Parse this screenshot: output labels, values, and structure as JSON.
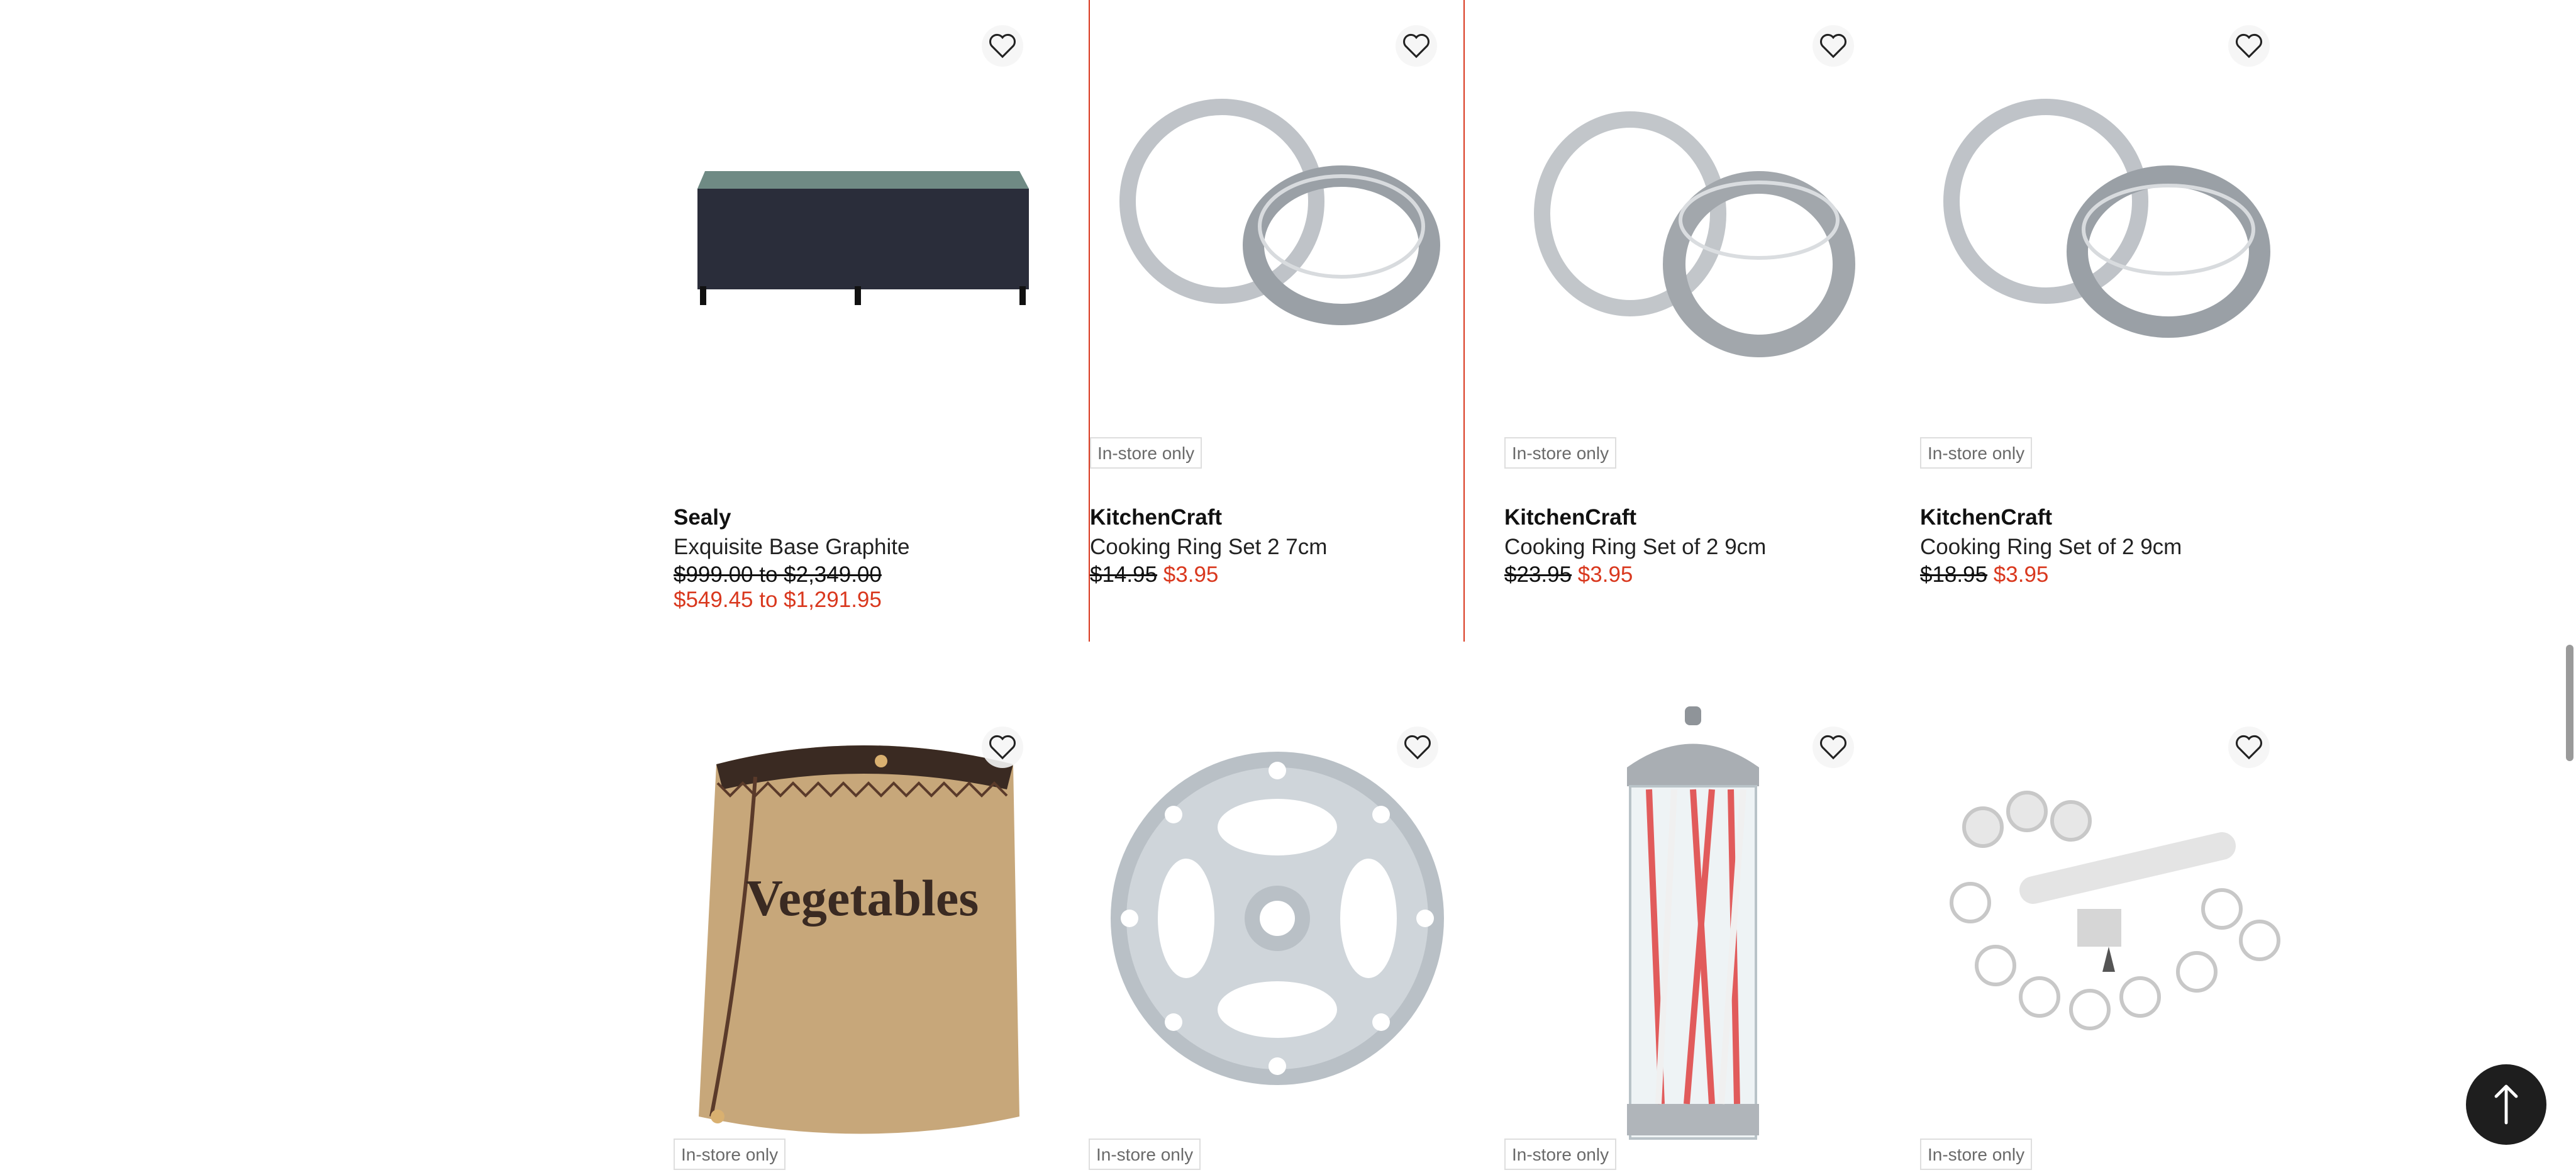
{
  "products_row1": [
    {
      "brand": "Sealy",
      "name": "Exquisite Base Graphite",
      "was": "$999.00 to $2,349.00",
      "now": "$549.45 to $1,291.95",
      "badge": ""
    },
    {
      "brand": "KitchenCraft",
      "name": "Cooking Ring Set 2 7cm",
      "was": "$14.95",
      "now": "$3.95",
      "badge": "In-store only"
    },
    {
      "brand": "KitchenCraft",
      "name": "Cooking Ring Set of 2 9cm",
      "was": "$23.95",
      "now": "$3.95",
      "badge": "In-store only"
    },
    {
      "brand": "KitchenCraft",
      "name": "Cooking Ring Set of 2 9cm",
      "was": "$18.95",
      "now": "$3.95",
      "badge": "In-store only"
    }
  ],
  "products_row2": [
    {
      "image_text": "Vegetables",
      "badge": "In-store only"
    },
    {
      "badge": "In-store only"
    },
    {
      "badge": "In-store only"
    },
    {
      "badge": "In-store only"
    }
  ],
  "icons": {
    "wishlist": "heart-outline-icon",
    "back_to_top": "arrow-up-icon"
  },
  "colors": {
    "sale": "#d9381e",
    "focus_border": "#d9381e",
    "badge_text": "#6a6a6a"
  }
}
